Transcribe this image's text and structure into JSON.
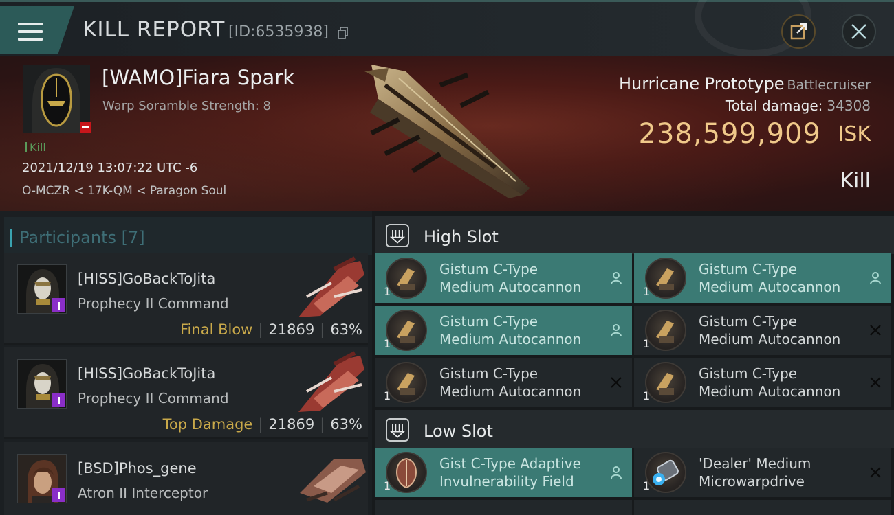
{
  "header": {
    "title": "KILL REPORT",
    "report_id": "[ID:6535938]"
  },
  "victim": {
    "name": "[WAMO]Fiara Spark",
    "warp_scramble": "Warp Soramble Strength: 8",
    "kill_tag": "Kill",
    "timestamp": "2021/12/19 13:07:22 UTC -6",
    "location": "O-MCZR < 17K-QM < Paragon Soul",
    "ship_name": "Hurricane Prototype",
    "ship_class": "Battlecruiser",
    "total_damage_label": "Total damage:",
    "total_damage": "34308",
    "isk_value": "238,599,909",
    "isk_unit": "ISK",
    "status": "Kill"
  },
  "participants": {
    "title": "Participants [7]",
    "rows": [
      {
        "name": "[HISS]GoBackToJita",
        "ship": "Prophecy II Command",
        "label": "Final Blow",
        "damage": "21869",
        "percent": "63%"
      },
      {
        "name": "[HISS]GoBackToJita",
        "ship": "Prophecy II Command",
        "label": "Top Damage",
        "damage": "21869",
        "percent": "63%"
      },
      {
        "name": "[BSD]Phos_gene",
        "ship": "Atron II Interceptor",
        "label": "",
        "damage": "",
        "percent": ""
      }
    ]
  },
  "high_slot": {
    "title": "High Slot",
    "modules": [
      {
        "line1": "Gistum C-Type",
        "line2": "Medium Autocannon",
        "qty": "1",
        "state": "active"
      },
      {
        "line1": "Gistum C-Type",
        "line2": "Medium Autocannon",
        "qty": "1",
        "state": "active"
      },
      {
        "line1": "Gistum C-Type",
        "line2": "Medium Autocannon",
        "qty": "1",
        "state": "active"
      },
      {
        "line1": "Gistum C-Type",
        "line2": "Medium Autocannon",
        "qty": "1",
        "state": "destroyed"
      },
      {
        "line1": "Gistum C-Type",
        "line2": "Medium Autocannon",
        "qty": "1",
        "state": "destroyed"
      },
      {
        "line1": "Gistum C-Type",
        "line2": "Medium Autocannon",
        "qty": "1",
        "state": "destroyed"
      }
    ]
  },
  "low_slot": {
    "title": "Low Slot",
    "modules": [
      {
        "line1": "Gist C-Type Adaptive",
        "line2": "Invulnerability Field",
        "qty": "1",
        "state": "active"
      },
      {
        "line1": "'Dealer' Medium",
        "line2": "Microwarpdrive",
        "qty": "1",
        "state": "destroyed"
      }
    ]
  },
  "colors": {
    "accent_teal": "#3b7a74",
    "isk_gold": "#f0c98a",
    "final_blow": "#c9a94a",
    "security_red": "#c8161b",
    "corp_purple": "#8a2ec8"
  }
}
